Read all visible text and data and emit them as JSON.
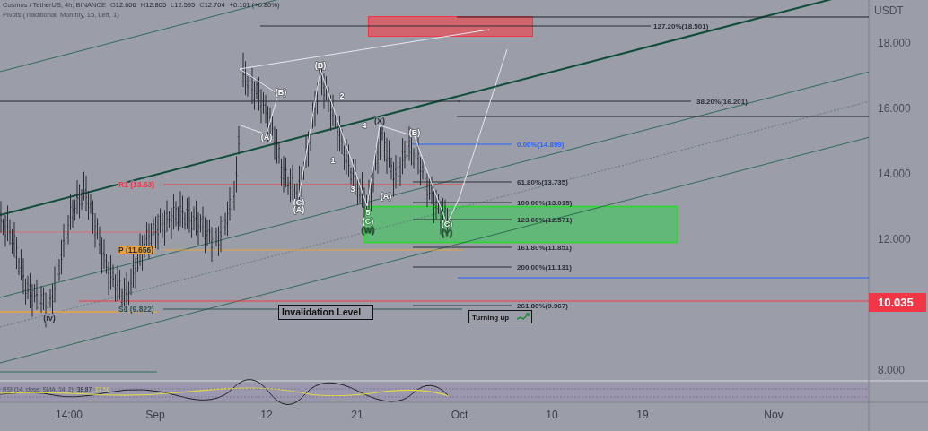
{
  "legend": {
    "title": "Cosmos / TetherUS, 4h, BINANCE",
    "ohlc": [
      {
        "label": "O",
        "value": "12.606"
      },
      {
        "label": "H",
        "value": "12.805"
      },
      {
        "label": "L",
        "value": "12.595"
      },
      {
        "label": "C",
        "value": "12.704"
      }
    ],
    "change": "+0.101 (+0.80%)",
    "indicator": "Pivots (Traditional, Monthly, 15, Left, 1)"
  },
  "fib_levels": [
    {
      "label": "127.20%(18.501)",
      "color": "#2a2e39"
    },
    {
      "label": "38.20%(16.201)",
      "color": "#2a2e39"
    },
    {
      "label": "0.00%(14.899)",
      "color": "#2962ff"
    },
    {
      "label": "61.80%(13.735)",
      "color": "#2a2e39"
    },
    {
      "label": "100.00%(13.015)",
      "color": "#2a2e39"
    },
    {
      "label": "123.60%(12.571)",
      "color": "#2a2e39"
    },
    {
      "label": "161.80%(11.851)",
      "color": "#2a2e39"
    },
    {
      "label": "200.00%(11.131)",
      "color": "#2a2e39"
    },
    {
      "label": "261.80%(9.967)",
      "color": "#2a2e39"
    }
  ],
  "pivots": [
    {
      "label": "R1 (13.63)",
      "color": "#f23645"
    },
    {
      "label": "P (11.656)",
      "color": "#e8a33c"
    },
    {
      "label": "S1 (9.822)",
      "color": "#2f4f4f"
    }
  ],
  "wave_labels": [
    {
      "label": "(B)",
      "color": "#ffffff"
    },
    {
      "label": "(A)",
      "color": "#ffffff"
    },
    {
      "label": "(B)",
      "color": "#ffffff"
    },
    {
      "label": "2",
      "color": "#ffffff"
    },
    {
      "label": "1",
      "color": "#ffffff"
    },
    {
      "label": "4",
      "color": "#ffffff"
    },
    {
      "label": "(X)",
      "color": "#2a2e39"
    },
    {
      "label": "(B)",
      "color": "#ffffff"
    },
    {
      "label": "3",
      "color": "#ffffff"
    },
    {
      "label": "(A)",
      "color": "#ffffff"
    },
    {
      "label": "(C)",
      "color": "#ffffff"
    },
    {
      "label": "(A)",
      "color": "#ffffff"
    },
    {
      "label": "5",
      "color": "#e8ffe8"
    },
    {
      "label": "(C)",
      "color": "#e8ffe8"
    },
    {
      "label": "(W)",
      "color": "#1e4d2b"
    },
    {
      "label": "(C)",
      "color": "#e8ffe8"
    },
    {
      "label": "(Y)",
      "color": "#1e4d2b"
    },
    {
      "label": "(iv)",
      "color": "#2a2e39"
    }
  ],
  "notes": [
    {
      "kind": "plain",
      "text": "Invalidation Level"
    },
    {
      "kind": "trend-up",
      "text": "Turning up"
    }
  ],
  "rsi": {
    "label": "RSI (14, close, SMA, 14, 2)",
    "value": "38.87",
    "average": "37.56"
  },
  "price_axis": {
    "unit": "USDT",
    "ticks": [
      "18.000",
      "16.000",
      "14.000",
      "12.000",
      "8.000"
    ],
    "last_price": "10.035"
  },
  "time_axis": [
    "14:00",
    "Sep",
    "12",
    "21",
    "Oct",
    "10",
    "19",
    "Nov"
  ]
}
